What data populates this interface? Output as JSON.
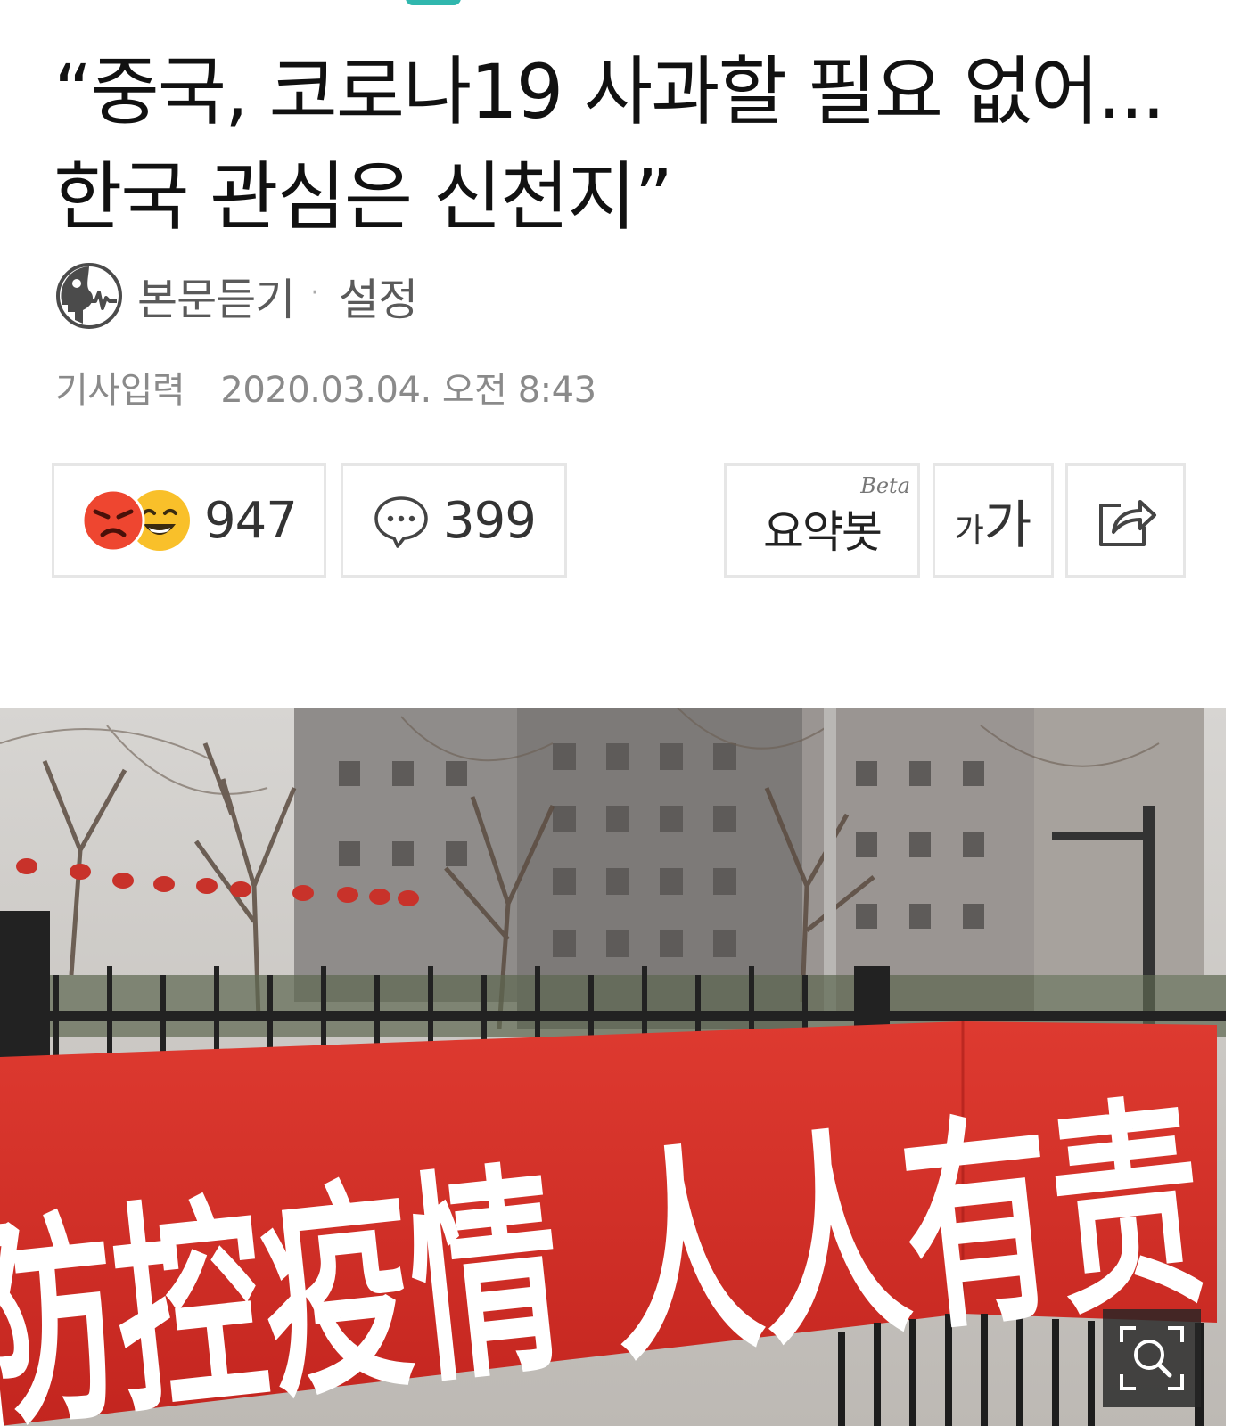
{
  "article": {
    "title": "“중국, 코로나19 사과할 필요 없어...한국 관심은 신천지”",
    "listen_label": "본문듣기",
    "separator": "·",
    "settings_label": "설정",
    "date_label": "기사입력",
    "date_value": "2020.03.04. 오전 8:43"
  },
  "toolbar": {
    "reaction_count": "947",
    "comment_count": "399",
    "summary_label": "요약봇",
    "summary_badge": "Beta",
    "font_small": "가",
    "font_large": "가"
  },
  "photo": {
    "banner_text": "防控疫情 人人有责"
  },
  "colors": {
    "accent": "#30b7ae",
    "banner_red": "#cf2f2a",
    "angry_emoji": "#ee4630",
    "laugh_emoji": "#f9c02a"
  },
  "icons": {
    "listen": "speaker-head-icon",
    "comment": "speech-bubble-icon",
    "share": "share-icon",
    "zoom": "zoom-icon"
  }
}
